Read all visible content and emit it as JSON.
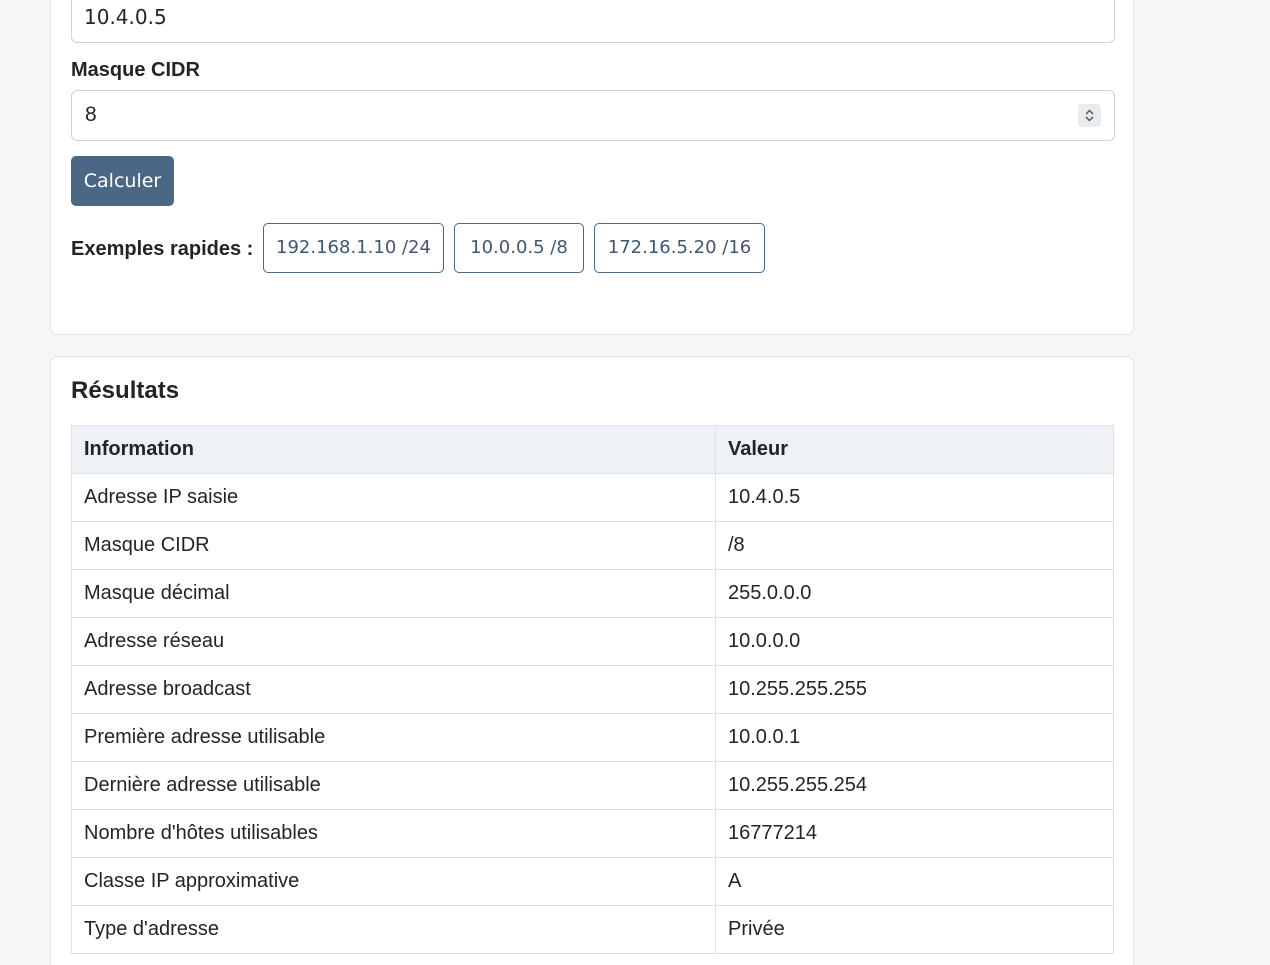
{
  "form": {
    "ip_value": "10.4.0.5",
    "cidr_label": "Masque CIDR",
    "cidr_value": "8",
    "calculate_label": "Calculer",
    "examples_label": "Exemples rapides :",
    "examples": [
      "192.168.1.10 /24",
      "10.0.0.5 /8",
      "172.16.5.20 /16"
    ]
  },
  "results": {
    "title": "Résultats",
    "columns": [
      "Information",
      "Valeur"
    ],
    "rows": [
      [
        "Adresse IP saisie",
        "10.4.0.5"
      ],
      [
        "Masque CIDR",
        "/8"
      ],
      [
        "Masque décimal",
        "255.0.0.0"
      ],
      [
        "Adresse réseau",
        "10.0.0.0"
      ],
      [
        "Adresse broadcast",
        "10.255.255.255"
      ],
      [
        "Première adresse utilisable",
        "10.0.0.1"
      ],
      [
        "Dernière adresse utilisable",
        "10.255.255.254"
      ],
      [
        "Nombre d'hôtes utilisables",
        "16777214"
      ],
      [
        "Classe IP approximative",
        "A"
      ],
      [
        "Type d'adresse",
        "Privée"
      ]
    ]
  },
  "colors": {
    "page_bg": "#f4f6f8",
    "accent": "#4a6785",
    "table_header_bg": "#eef2f7"
  }
}
